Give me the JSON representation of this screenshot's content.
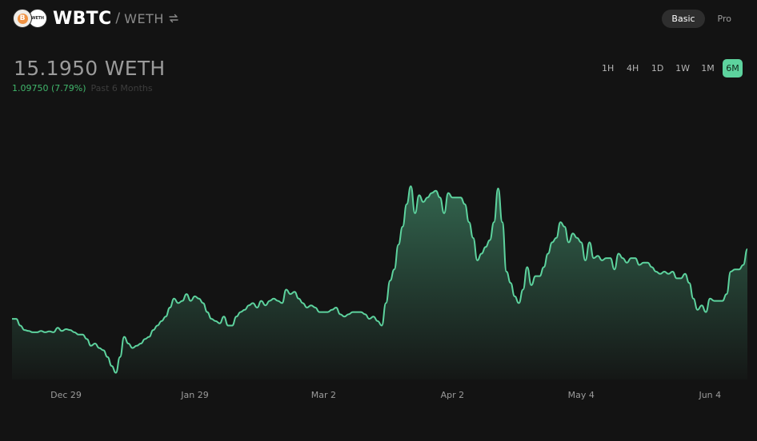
{
  "header": {
    "base_token": "WBTC",
    "separator": "/",
    "quote_token": "WETH",
    "base_icon_glyph": "B",
    "quote_icon_text": "WETH",
    "icons": [
      "wbtc-token-icon",
      "weth-token-icon",
      "swap-arrows-icon"
    ]
  },
  "mode_toggle": {
    "basic_label": "Basic",
    "pro_label": "Pro",
    "active": "Basic"
  },
  "price": {
    "value": "15.1950 WETH"
  },
  "change": {
    "value": "1.09750 (7.79%)",
    "period": "Past 6 Months"
  },
  "time_ranges": {
    "items": [
      "1H",
      "4H",
      "1D",
      "1W",
      "1M",
      "6M"
    ],
    "active": "6M"
  },
  "colors": {
    "line": "#5dd39e",
    "positive": "#40b66b",
    "background": "#131313",
    "active_range": "#5dd39e"
  },
  "chart_data": {
    "type": "area",
    "x_ticks": [
      {
        "label": "Dec 29",
        "day": 13
      },
      {
        "label": "Jan 29",
        "day": 44
      },
      {
        "label": "Mar 2",
        "day": 75
      },
      {
        "label": "Apr 2",
        "day": 106
      },
      {
        "label": "May 4",
        "day": 137
      },
      {
        "label": "Jun 4",
        "day": 168
      }
    ],
    "xlim": [
      0,
      177
    ],
    "ylim": [
      12.8,
      17.6
    ],
    "grid": false,
    "series": [
      {
        "values": [
          [
            0,
            14.15
          ],
          [
            1,
            14.15
          ],
          [
            2,
            14.0
          ],
          [
            3,
            13.9
          ],
          [
            4,
            13.88
          ],
          [
            5,
            13.85
          ],
          [
            6,
            13.85
          ],
          [
            7,
            13.88
          ],
          [
            8,
            13.85
          ],
          [
            9,
            13.87
          ],
          [
            10,
            13.85
          ],
          [
            11,
            13.95
          ],
          [
            12,
            13.88
          ],
          [
            13,
            13.92
          ],
          [
            14,
            13.9
          ],
          [
            15,
            13.85
          ],
          [
            16,
            13.8
          ],
          [
            17,
            13.8
          ],
          [
            18,
            13.7
          ],
          [
            19,
            13.55
          ],
          [
            20,
            13.6
          ],
          [
            21,
            13.5
          ],
          [
            22,
            13.45
          ],
          [
            23,
            13.3
          ],
          [
            24,
            13.1
          ],
          [
            25,
            12.95
          ],
          [
            26,
            13.3
          ],
          [
            27,
            13.75
          ],
          [
            28,
            13.6
          ],
          [
            29,
            13.5
          ],
          [
            30,
            13.55
          ],
          [
            31,
            13.6
          ],
          [
            32,
            13.7
          ],
          [
            33,
            13.75
          ],
          [
            34,
            13.9
          ],
          [
            35,
            14.0
          ],
          [
            36,
            14.1
          ],
          [
            37,
            14.2
          ],
          [
            38,
            14.4
          ],
          [
            39,
            14.6
          ],
          [
            40,
            14.5
          ],
          [
            41,
            14.55
          ],
          [
            42,
            14.7
          ],
          [
            43,
            14.55
          ],
          [
            44,
            14.65
          ],
          [
            45,
            14.6
          ],
          [
            46,
            14.5
          ],
          [
            47,
            14.3
          ],
          [
            48,
            14.15
          ],
          [
            49,
            14.1
          ],
          [
            50,
            14.05
          ],
          [
            51,
            14.2
          ],
          [
            52,
            14.0
          ],
          [
            53,
            14.0
          ],
          [
            54,
            14.2
          ],
          [
            55,
            14.3
          ],
          [
            56,
            14.35
          ],
          [
            57,
            14.45
          ],
          [
            58,
            14.5
          ],
          [
            59,
            14.4
          ],
          [
            60,
            14.55
          ],
          [
            61,
            14.45
          ],
          [
            62,
            14.55
          ],
          [
            63,
            14.6
          ],
          [
            64,
            14.55
          ],
          [
            65,
            14.5
          ],
          [
            66,
            14.8
          ],
          [
            67,
            14.7
          ],
          [
            68,
            14.75
          ],
          [
            69,
            14.6
          ],
          [
            70,
            14.5
          ],
          [
            71,
            14.4
          ],
          [
            72,
            14.45
          ],
          [
            73,
            14.4
          ],
          [
            74,
            14.3
          ],
          [
            75,
            14.3
          ],
          [
            76,
            14.3
          ],
          [
            77,
            14.35
          ],
          [
            78,
            14.4
          ],
          [
            79,
            14.25
          ],
          [
            80,
            14.2
          ],
          [
            81,
            14.25
          ],
          [
            82,
            14.3
          ],
          [
            83,
            14.3
          ],
          [
            84,
            14.3
          ],
          [
            85,
            14.25
          ],
          [
            86,
            14.15
          ],
          [
            87,
            14.2
          ],
          [
            88,
            14.1
          ],
          [
            89,
            14.0
          ],
          [
            90,
            14.5
          ],
          [
            91,
            15.0
          ],
          [
            92,
            15.25
          ],
          [
            93,
            15.8
          ],
          [
            94,
            16.2
          ],
          [
            95,
            16.7
          ],
          [
            96,
            17.1
          ],
          [
            97,
            16.5
          ],
          [
            98,
            16.9
          ],
          [
            99,
            16.75
          ],
          [
            100,
            16.85
          ],
          [
            101,
            16.95
          ],
          [
            102,
            17.0
          ],
          [
            103,
            16.85
          ],
          [
            104,
            16.5
          ],
          [
            105,
            16.95
          ],
          [
            106,
            16.85
          ],
          [
            107,
            16.85
          ],
          [
            108,
            16.85
          ],
          [
            109,
            16.7
          ],
          [
            110,
            16.3
          ],
          [
            111,
            15.95
          ],
          [
            112,
            15.45
          ],
          [
            113,
            15.6
          ],
          [
            114,
            15.75
          ],
          [
            115,
            15.9
          ],
          [
            116,
            16.3
          ],
          [
            117,
            17.05
          ],
          [
            118,
            16.3
          ],
          [
            119,
            15.2
          ],
          [
            120,
            14.95
          ],
          [
            121,
            14.65
          ],
          [
            122,
            14.5
          ],
          [
            123,
            14.8
          ],
          [
            124,
            15.3
          ],
          [
            125,
            14.9
          ],
          [
            126,
            15.1
          ],
          [
            127,
            15.1
          ],
          [
            128,
            15.3
          ],
          [
            129,
            15.6
          ],
          [
            130,
            15.85
          ],
          [
            131,
            15.95
          ],
          [
            132,
            16.3
          ],
          [
            133,
            16.2
          ],
          [
            134,
            15.85
          ],
          [
            135,
            16.05
          ],
          [
            136,
            15.95
          ],
          [
            137,
            15.85
          ],
          [
            138,
            15.45
          ],
          [
            139,
            15.85
          ],
          [
            140,
            15.5
          ],
          [
            141,
            15.55
          ],
          [
            142,
            15.45
          ],
          [
            143,
            15.5
          ],
          [
            144,
            15.5
          ],
          [
            145,
            15.25
          ],
          [
            146,
            15.6
          ],
          [
            147,
            15.5
          ],
          [
            148,
            15.4
          ],
          [
            149,
            15.5
          ],
          [
            150,
            15.5
          ],
          [
            151,
            15.35
          ],
          [
            152,
            15.4
          ],
          [
            153,
            15.4
          ],
          [
            154,
            15.3
          ],
          [
            155,
            15.2
          ],
          [
            156,
            15.15
          ],
          [
            157,
            15.2
          ],
          [
            158,
            15.15
          ],
          [
            159,
            15.2
          ],
          [
            160,
            15.05
          ],
          [
            161,
            15.05
          ],
          [
            162,
            15.15
          ],
          [
            163,
            14.95
          ],
          [
            164,
            14.6
          ],
          [
            165,
            14.35
          ],
          [
            166,
            14.45
          ],
          [
            167,
            14.3
          ],
          [
            168,
            14.6
          ],
          [
            169,
            14.55
          ],
          [
            170,
            14.55
          ],
          [
            171,
            14.55
          ],
          [
            172,
            14.7
          ],
          [
            173,
            15.2
          ],
          [
            174,
            15.25
          ],
          [
            175,
            15.25
          ],
          [
            176,
            15.35
          ],
          [
            177,
            15.7
          ]
        ]
      }
    ]
  }
}
